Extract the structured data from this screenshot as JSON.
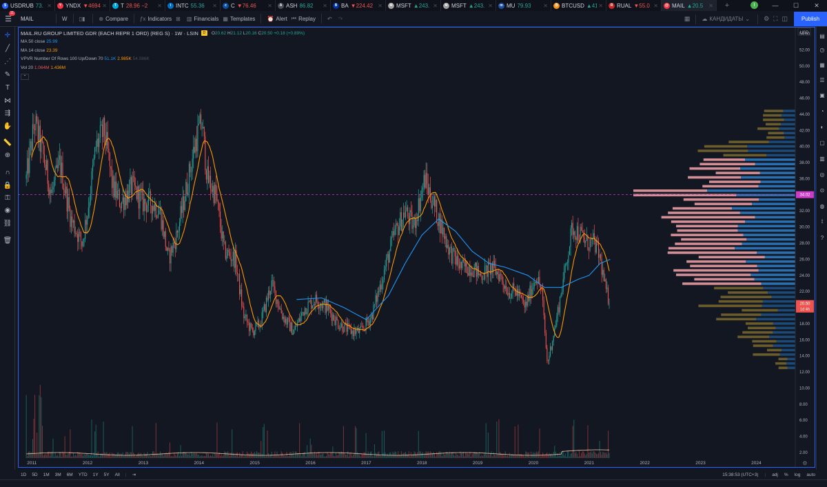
{
  "tabs": [
    {
      "symbol": "USDRUB",
      "value": "73.",
      "dir": "up",
      "icon_color": "#2962ff",
      "icon": "$"
    },
    {
      "symbol": "YNDX",
      "value": "▼4694",
      "dir": "down",
      "icon_color": "#f23645",
      "icon": "Y"
    },
    {
      "symbol": "T",
      "value": "28.96 −2",
      "dir": "down",
      "icon_color": "#00a8e0",
      "icon": "T"
    },
    {
      "symbol": "INTC",
      "value": "55.36",
      "dir": "up",
      "icon_color": "#0071c5",
      "icon": "i"
    },
    {
      "symbol": "C",
      "value": "▼76.46",
      "dir": "down",
      "icon_color": "#0a4f9e",
      "icon": "c"
    },
    {
      "symbol": "ASH",
      "value": "86.82",
      "dir": "up",
      "icon_color": "#4a4e5a",
      "icon": "A"
    },
    {
      "symbol": "BA",
      "value": "▼224.42",
      "dir": "down",
      "icon_color": "#0033a0",
      "icon": "B"
    },
    {
      "symbol": "MSFT",
      "value": "▲243.",
      "dir": "up",
      "icon_color": "#9e9e9e",
      "icon": "M"
    },
    {
      "symbol": "MSFT",
      "value": "▲243.",
      "dir": "up",
      "icon_color": "#9e9e9e",
      "icon": "M"
    },
    {
      "symbol": "MU",
      "value": "79.93",
      "dir": "up",
      "icon_color": "#1e4ea1",
      "icon": "m"
    },
    {
      "symbol": "BTCUSD",
      "value": "▲41",
      "dir": "up",
      "icon_color": "#f7931a",
      "icon": "₿"
    },
    {
      "symbol": "RUAL",
      "value": "▼55.0",
      "dir": "down",
      "icon_color": "#c62828",
      "icon": "R"
    },
    {
      "symbol": "MAIL",
      "value": "▲20.5",
      "dir": "up",
      "icon_color": "#f23645",
      "icon": "@",
      "active": true
    }
  ],
  "user_initial": "I",
  "toolbar": {
    "notification_count": "11",
    "symbol": "MAIL",
    "interval": "W",
    "compare": "Compare",
    "indicators": "Indicators",
    "financials": "Financials",
    "templates": "Templates",
    "alert": "Alert",
    "replay": "Replay",
    "layout_name": "КАНДИДАТЫ",
    "publish": "Publish"
  },
  "legend": {
    "title": "MAIL.RU GROUP LIMITED GDR (EACH REPR 1 ORD) (REG S) · 1W · LSIN",
    "badge": "D",
    "o_label": "O",
    "o": "20.62",
    "h_label": "H",
    "h": "21.12",
    "l_label": "L",
    "l": "20.16",
    "c_label": "C",
    "c": "20.50",
    "chg": "+0.18 (+0.89%)",
    "ma50_label": "MA 50 close",
    "ma50": "25.99",
    "ma14_label": "MA 14 close",
    "ma14": "23.39",
    "vpvr_label": "VPVR Number Of Rows 100 Up/Down 70",
    "vpvr_up": "51.1K",
    "vpvr_down": "2.985K",
    "vpvr_total": "54.086K",
    "vol_label": "Vol 20",
    "vol": "1.064M",
    "vol_ma": "1.436M"
  },
  "price_axis": {
    "currency": "USD",
    "ticks": [
      "54.00",
      "52.00",
      "50.00",
      "48.00",
      "46.00",
      "44.00",
      "42.00",
      "40.00",
      "38.00",
      "36.00",
      "34.00",
      "32.00",
      "30.00",
      "28.00",
      "26.00",
      "24.00",
      "22.00",
      "20.00",
      "18.00",
      "16.00",
      "14.00",
      "12.00",
      "10.00",
      "8.00",
      "6.00",
      "4.00",
      "2.00"
    ],
    "crosshair_price": "34.02",
    "last_price": "20.50",
    "countdown": "1d 4h"
  },
  "time_axis": [
    "2011",
    "2012",
    "2013",
    "2014",
    "2015",
    "2016",
    "2017",
    "2018",
    "2019",
    "2020",
    "2021",
    "2022",
    "2023",
    "2024"
  ],
  "bottom": {
    "ranges": [
      "1D",
      "5D",
      "1M",
      "3M",
      "6M",
      "YTD",
      "1Y",
      "5Y",
      "All"
    ],
    "clock": "15:38:53 (UTC+3)",
    "adj": "adj",
    "pct": "%",
    "log": "log",
    "auto": "auto"
  },
  "colors": {
    "background": "#131722",
    "up": "#26a69a",
    "down": "#ef5350",
    "ma50": "#2196f3",
    "ma14": "#ff9800",
    "vp_up": "#2a6fb0",
    "vp_down": "#d48e95",
    "vp_up_dim": "#1b4a78",
    "vp_down_dim": "#6b5c2b",
    "crosshair": "#cc3cc8",
    "accent": "#2962ff"
  },
  "chart_data": {
    "type": "candlestick",
    "title": "MAIL.RU GROUP LIMITED GDR (EACH REPR 1 ORD) (REG S)",
    "interval": "1W",
    "xlim": [
      2010.75,
      2024.7
    ],
    "ylim": [
      2,
      54
    ],
    "key_points": [
      [
        2010.9,
        36
      ],
      [
        2011.05,
        43
      ],
      [
        2011.2,
        39
      ],
      [
        2011.35,
        34
      ],
      [
        2011.5,
        38
      ],
      [
        2011.7,
        31
      ],
      [
        2011.9,
        28
      ],
      [
        2012.0,
        32
      ],
      [
        2012.15,
        40
      ],
      [
        2012.3,
        42
      ],
      [
        2012.45,
        35
      ],
      [
        2012.6,
        33
      ],
      [
        2012.8,
        35
      ],
      [
        2013.0,
        33
      ],
      [
        2013.15,
        33
      ],
      [
        2013.3,
        32
      ],
      [
        2013.45,
        26
      ],
      [
        2013.6,
        29
      ],
      [
        2013.75,
        34
      ],
      [
        2013.95,
        41
      ],
      [
        2014.05,
        43
      ],
      [
        2014.15,
        36
      ],
      [
        2014.3,
        34
      ],
      [
        2014.45,
        27
      ],
      [
        2014.65,
        26
      ],
      [
        2014.8,
        19
      ],
      [
        2014.95,
        17
      ],
      [
        2015.1,
        18
      ],
      [
        2015.3,
        23
      ],
      [
        2015.5,
        19
      ],
      [
        2015.7,
        17
      ],
      [
        2015.9,
        20
      ],
      [
        2016.1,
        21
      ],
      [
        2016.3,
        20
      ],
      [
        2016.5,
        18
      ],
      [
        2016.75,
        17
      ],
      [
        2016.9,
        17
      ],
      [
        2017.1,
        19
      ],
      [
        2017.3,
        24
      ],
      [
        2017.5,
        29
      ],
      [
        2017.7,
        32
      ],
      [
        2017.85,
        30
      ],
      [
        2018.05,
        36
      ],
      [
        2018.2,
        33
      ],
      [
        2018.35,
        30
      ],
      [
        2018.5,
        27
      ],
      [
        2018.7,
        25
      ],
      [
        2018.9,
        25
      ],
      [
        2019.05,
        24
      ],
      [
        2019.25,
        25
      ],
      [
        2019.4,
        24
      ],
      [
        2019.55,
        22
      ],
      [
        2019.7,
        22
      ],
      [
        2019.85,
        20
      ],
      [
        2020.05,
        24
      ],
      [
        2020.15,
        22
      ],
      [
        2020.25,
        13
      ],
      [
        2020.4,
        18
      ],
      [
        2020.55,
        24
      ],
      [
        2020.7,
        30
      ],
      [
        2020.85,
        29
      ],
      [
        2020.95,
        28
      ],
      [
        2021.1,
        28
      ],
      [
        2021.2,
        26
      ],
      [
        2021.3,
        22
      ],
      [
        2021.38,
        20.5
      ]
    ],
    "ma50_points": [
      [
        2015.75,
        21.0
      ],
      [
        2016.2,
        21.2
      ],
      [
        2016.6,
        20.0
      ],
      [
        2017.0,
        18.5
      ],
      [
        2017.4,
        21.5
      ],
      [
        2017.7,
        25.5
      ],
      [
        2018.0,
        29.0
      ],
      [
        2018.3,
        31.0
      ],
      [
        2018.6,
        29.5
      ],
      [
        2018.9,
        27.0
      ],
      [
        2019.2,
        25.5
      ],
      [
        2019.5,
        25.0
      ],
      [
        2019.9,
        24.0
      ],
      [
        2020.2,
        22.5
      ],
      [
        2020.5,
        22.5
      ],
      [
        2020.8,
        23.5
      ],
      [
        2021.0,
        24.0
      ],
      [
        2021.2,
        25.5
      ],
      [
        2021.38,
        25.99
      ]
    ],
    "volume_profile": {
      "point_of_control": 34.02,
      "value_area": [
        22.5,
        38.5
      ]
    }
  }
}
